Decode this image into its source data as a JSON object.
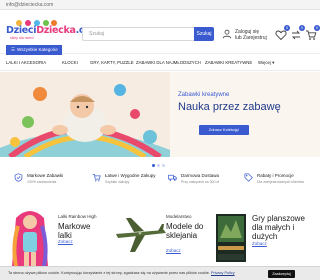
{
  "topbar": {
    "email": "info@dzieciecka.com"
  },
  "logo": {
    "part1": "Dzieci",
    "part2": "Dziecka",
    "suffix": ".com",
    "tagline": "sklep dla dzieci"
  },
  "search": {
    "placeholder": "Szukaj",
    "button": "Szukaj"
  },
  "account": {
    "line1": "Zaloguj się",
    "line2": "lub Zarejestruj"
  },
  "header_icons": [
    {
      "name": "heart-icon",
      "count": "0"
    },
    {
      "name": "compare-icon",
      "count": "0"
    },
    {
      "name": "cart-icon",
      "count": "0"
    }
  ],
  "category_button": "Wszystkie Kategorie",
  "nav": [
    "LALKI I AKCESORIA",
    "KLOCKI",
    "GRY, KARTY, PUZZLE",
    "ZABAWKI DLA NAJMŁODSZYCH",
    "ZABAWKI KREATYWNE",
    "Więcej"
  ],
  "hero": {
    "subtitle": "Zabawki kreatywne",
    "title": "Nauka przez zabawę",
    "cta": "Zobacz Kolekcję!",
    "slides": 3,
    "active_slide": 1
  },
  "features": [
    {
      "icon": "shield-check-icon",
      "title": "Markowe Zabawki",
      "subtitle": "100% zadowolenia"
    },
    {
      "icon": "cart-icon",
      "title": "Łatwe i Wygodne Zakupy",
      "subtitle": "Szybkie zakupy"
    },
    {
      "icon": "truck-icon",
      "title": "Darmowa Dostawa",
      "subtitle": "Przy zakupach za 300 zł"
    },
    {
      "icon": "tag-icon",
      "title": "Rabaty i Promocje",
      "subtitle": "Dla zarejestrowanych klientów"
    }
  ],
  "promos": [
    {
      "small": "Lalki Rainbow High",
      "big": "Markowe lalki",
      "link": "Zobacz"
    },
    {
      "small": "Modelarstwo",
      "big": "Modele do sklejania",
      "link": "Zobacz"
    },
    {
      "small": "Planszówki",
      "big": "Gry planszowe dla małych i dużych",
      "link": "Zobacz"
    }
  ],
  "cookie": {
    "message": "Ta strona używa plików cookie. Kontynuując korzystanie z tej strony, zgadzasz się na używanie przez nas plików cookie.",
    "policy": "Privacy Policy",
    "accept": "Zaakceptuj"
  },
  "colors": {
    "brand": "#3a5bd0",
    "brand_pink": "#e8397c",
    "hero_bg": "#fbf5ef",
    "title_blue": "#1f3a8a"
  }
}
